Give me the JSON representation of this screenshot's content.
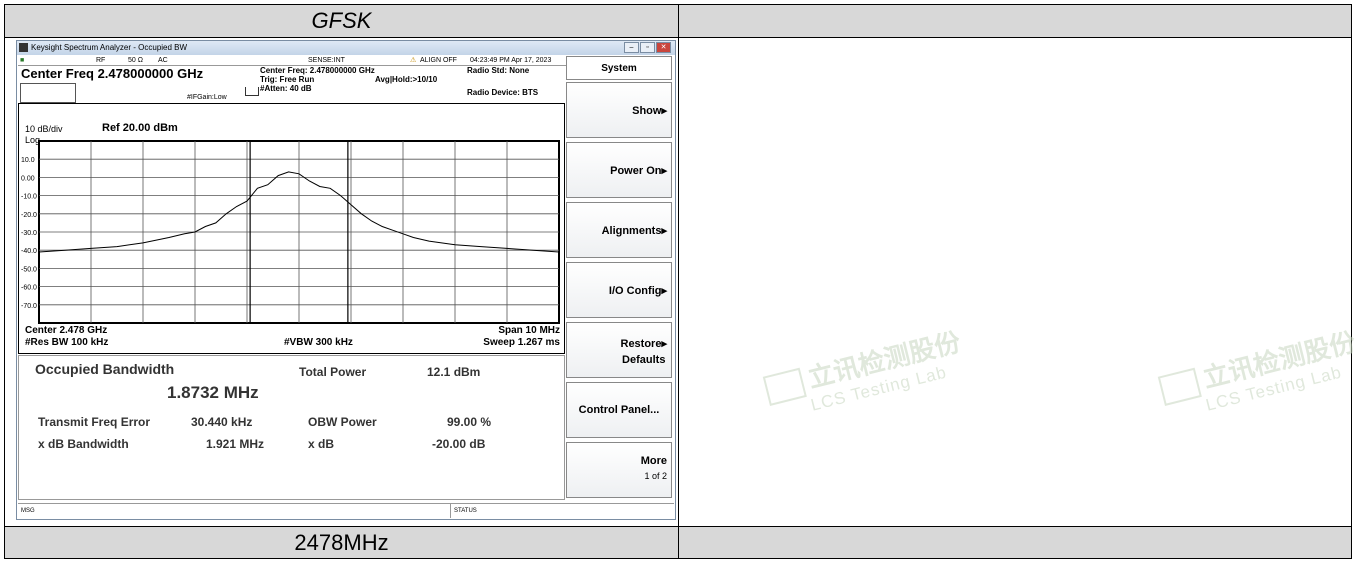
{
  "report": {
    "title": "GFSK",
    "footer": "2478MHz"
  },
  "watermark": {
    "cn": "立讯检测股份",
    "en": "LCS Testing Lab"
  },
  "window": {
    "title": "Keysight Spectrum Analyzer - Occupied BW",
    "controls": [
      "minimize-icon",
      "restore-icon",
      "close-icon"
    ]
  },
  "status_row": {
    "mode": "RF",
    "impedance": "50 Ω",
    "coupling": "AC",
    "sense": "SENSE:INT",
    "align": "ALIGN OFF",
    "datetime": "04:23:49 PM Apr 17, 2023"
  },
  "header": {
    "center_freq": "Center Freq 2.478000000 GHz",
    "if_gain": "#IFGain:Low",
    "params": [
      "Center Freq: 2.478000000 GHz",
      "Trig: Free Run",
      "#Atten: 40 dB"
    ],
    "avg_hold": "Avg|Hold:>10/10",
    "radio_std": "Radio Std: None",
    "radio_device": "Radio Device: BTS"
  },
  "graph": {
    "scale": "10 dB/div",
    "ref_level": "Ref 20.00 dBm",
    "log": "Log",
    "y_ticks": [
      "10.0",
      "0.00",
      "-10.0",
      "-20.0",
      "-30.0",
      "-40.0",
      "-50.0",
      "-60.0",
      "-70.0"
    ],
    "center": "Center  2.478 GHz",
    "res_bw": "#Res BW  100 kHz",
    "vbw": "#VBW  300 kHz",
    "span": "Span 10 MHz",
    "sweep": "Sweep  1.267 ms"
  },
  "results": {
    "obw_title": "Occupied Bandwidth",
    "obw_value": "1.8732 MHz",
    "total_power_label": "Total Power",
    "total_power_value": "12.1 dBm",
    "tx_freq_err_label": "Transmit Freq Error",
    "tx_freq_err_value": "30.440 kHz",
    "obw_power_label": "OBW Power",
    "obw_power_value": "99.00 %",
    "xdb_bw_label": "x dB Bandwidth",
    "xdb_bw_value": "1.921 MHz",
    "xdb_label": "x dB",
    "xdb_value": "-20.00 dB"
  },
  "bottom_bar": {
    "msg": "MSG",
    "status": "STATUS"
  },
  "menu": {
    "title": "System",
    "keys": {
      "show": "Show",
      "power_on": "Power On",
      "alignments": "Alignments",
      "io_config": "I/O Config",
      "restore_1": "Restore",
      "restore_2": "Defaults",
      "control_panel": "Control Panel...",
      "more": "More",
      "more_page": "1 of 2"
    }
  },
  "spectrum_trace": {
    "x_mhz": [
      -5.0,
      -4.5,
      -4.0,
      -3.5,
      -3.0,
      -2.5,
      -2.2,
      -2.0,
      -1.8,
      -1.6,
      -1.4,
      -1.2,
      -1.0,
      -0.8,
      -0.6,
      -0.4,
      -0.2,
      0.0,
      0.2,
      0.4,
      0.6,
      0.8,
      1.0,
      1.2,
      1.4,
      1.6,
      1.8,
      2.0,
      2.2,
      2.5,
      3.0,
      3.5,
      4.0,
      4.5,
      5.0
    ],
    "y_dbm": [
      -41,
      -40,
      -39,
      -38,
      -36,
      -33,
      -31,
      -30,
      -27,
      -25,
      -20,
      -16,
      -13,
      -6,
      -4,
      1,
      3,
      2,
      -2,
      -5,
      -6,
      -10,
      -15,
      -20,
      -24,
      -27,
      -29,
      -31,
      -33,
      -35,
      -37,
      -38,
      -39,
      -40,
      -41
    ],
    "ref_dbm": 20,
    "db_per_div": 10
  }
}
